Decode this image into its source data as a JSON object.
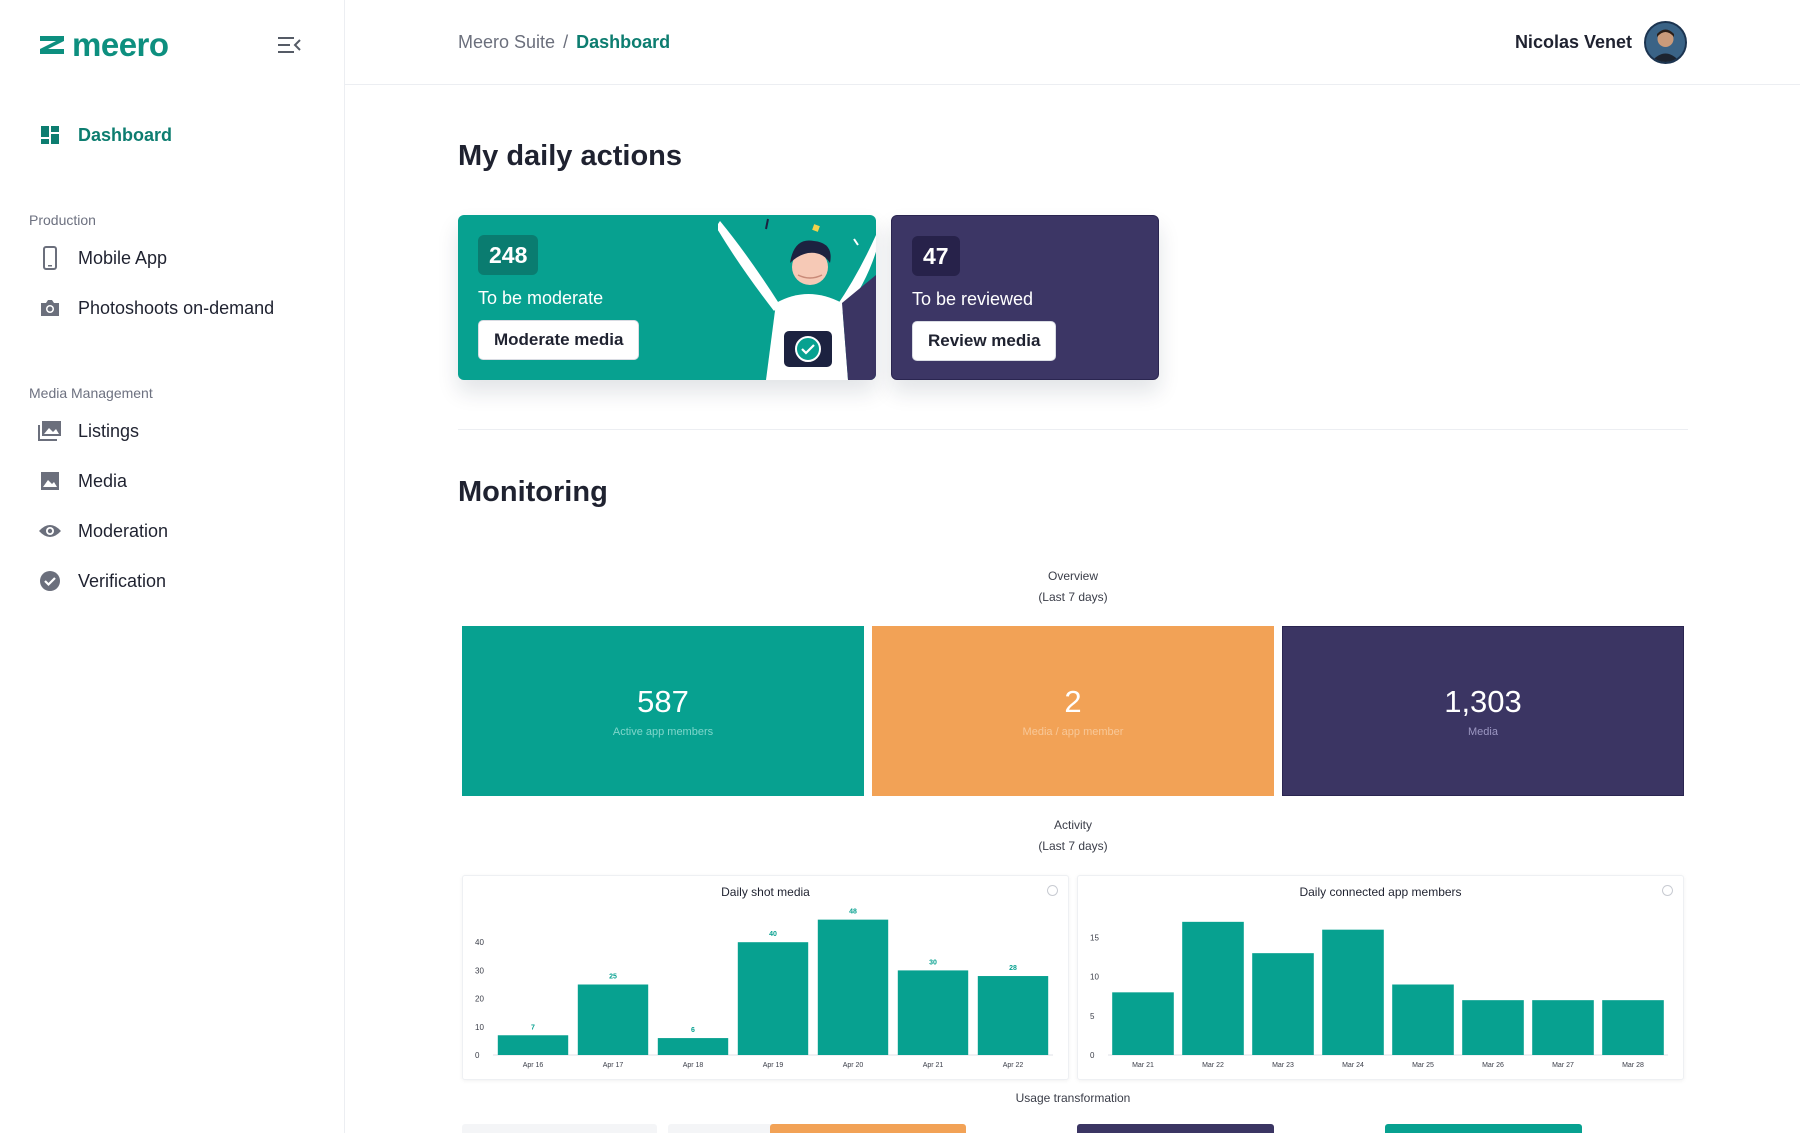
{
  "brand": {
    "logo_text": "meero",
    "accent": "#0d8f7f"
  },
  "sidebar": {
    "dashboard": "Dashboard",
    "sections": [
      {
        "label": "Production",
        "items": [
          {
            "label": "Mobile App",
            "icon": "smartphone-icon"
          },
          {
            "label": "Photoshoots on-demand",
            "icon": "camera-icon"
          }
        ]
      },
      {
        "label": "Media Management",
        "items": [
          {
            "label": "Listings",
            "icon": "images-icon"
          },
          {
            "label": "Media",
            "icon": "image-icon"
          },
          {
            "label": "Moderation",
            "icon": "eye-icon"
          },
          {
            "label": "Verification",
            "icon": "check-circle-icon"
          }
        ]
      }
    ]
  },
  "header": {
    "breadcrumb_root": "Meero Suite",
    "breadcrumb_sep": "/",
    "breadcrumb_current": "Dashboard",
    "user_name": "Nicolas Venet"
  },
  "daily": {
    "title": "My daily actions",
    "moderate": {
      "count": "248",
      "label": "To be moderate",
      "button": "Moderate media",
      "color": "#07a190"
    },
    "review": {
      "count": "47",
      "label": "To be reviewed",
      "button": "Review media",
      "color": "#3c3665"
    }
  },
  "monitoring": {
    "title": "Monitoring",
    "overview_title": "Overview",
    "overview_period": "(Last 7 days)",
    "tiles": [
      {
        "value": "587",
        "label": "Active app members",
        "color": "#07a190"
      },
      {
        "value": "2",
        "label": "Media / app member",
        "color": "#f2a256"
      },
      {
        "value": "1,303",
        "label": "Media",
        "color": "#3b3563"
      }
    ],
    "activity_title": "Activity",
    "activity_period": "(Last 7 days)",
    "usage_title": "Usage transformation"
  },
  "chart_data": [
    {
      "type": "bar",
      "title": "Daily shot media",
      "categories": [
        "Apr 16",
        "Apr 17",
        "Apr 18",
        "Apr 19",
        "Apr 20",
        "Apr 21",
        "Apr 22"
      ],
      "values": [
        7,
        25,
        6,
        40,
        48,
        30,
        28
      ],
      "data_labels": true,
      "yticks": [
        0,
        10,
        20,
        30,
        40
      ],
      "ylim": [
        0,
        50
      ],
      "color": "#07a190"
    },
    {
      "type": "bar",
      "title": "Daily connected app members",
      "categories": [
        "Mar 21",
        "Mar 22",
        "Mar 23",
        "Mar 24",
        "Mar 25",
        "Mar 26",
        "Mar 27",
        "Mar 28"
      ],
      "values": [
        8,
        17,
        13,
        16,
        9,
        7,
        7,
        7
      ],
      "data_labels": false,
      "yticks": [
        0,
        5,
        10,
        15
      ],
      "ylim": [
        0,
        18
      ],
      "color": "#07a190"
    }
  ]
}
